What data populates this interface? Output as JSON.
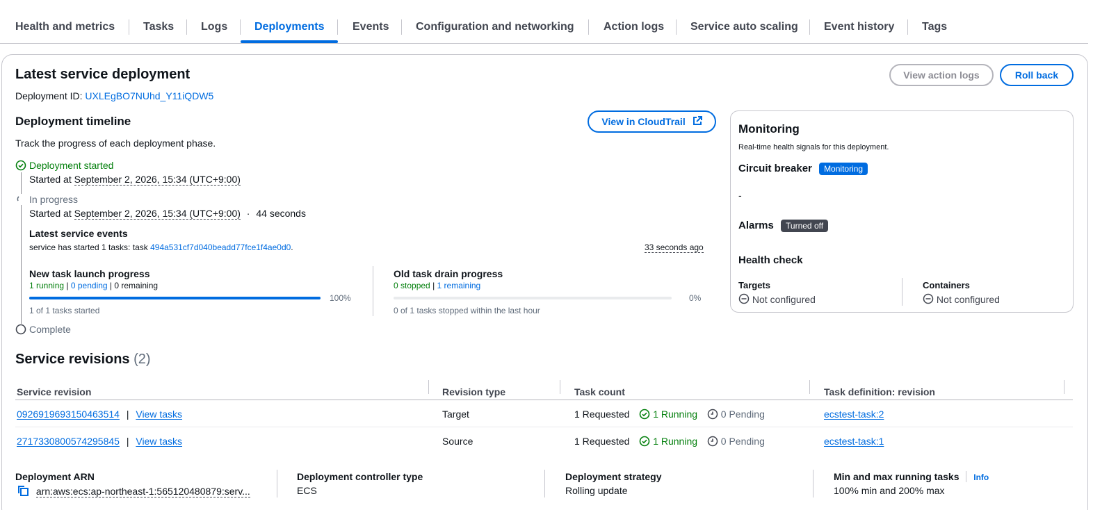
{
  "tabs": [
    {
      "label": "Health and metrics"
    },
    {
      "label": "Tasks"
    },
    {
      "label": "Logs"
    },
    {
      "label": "Deployments"
    },
    {
      "label": "Events"
    },
    {
      "label": "Configuration and networking"
    },
    {
      "label": "Action logs"
    },
    {
      "label": "Service auto scaling"
    },
    {
      "label": "Event history"
    },
    {
      "label": "Tags"
    }
  ],
  "deployment": {
    "title": "Latest service deployment",
    "id_label": "Deployment ID:",
    "id_value": "UXLEgBO7NUhd_Y11iQDW5",
    "view_action_logs": "View action logs",
    "roll_back": "Roll back"
  },
  "timeline": {
    "title": "Deployment timeline",
    "subtitle": "Track the progress of each deployment phase.",
    "cloudtrail_button": "View in CloudTrail",
    "started": {
      "status": "Deployment started",
      "label": "Started at",
      "time": "September 2, 2026, 15:34 (UTC+9:00)"
    },
    "in_progress": {
      "status": "In progress",
      "label": "Started at",
      "time": "September 2, 2026, 15:34 (UTC+9:00)",
      "sep": "·",
      "duration": "44 seconds"
    },
    "events": {
      "title": "Latest service events",
      "text": "service has started 1 tasks: task",
      "task_id": "494a531cf7d040beadd77fce1f4ae0d0",
      "period": ".",
      "ago": "33 seconds ago"
    },
    "new_task": {
      "title": "New task launch progress",
      "running": "1 running",
      "pipe": "|",
      "pending": "0 pending",
      "remaining": "| 0 remaining",
      "percent_label": "100%",
      "progress": 1.0,
      "footer": "1 of 1 tasks started"
    },
    "old_task": {
      "title": "Old task drain progress",
      "stopped": "0 stopped",
      "pipe": "|",
      "remaining": "1 remaining",
      "percent_label": "0%",
      "progress": 0.0,
      "footer": "0 of 1 tasks stopped within the last hour"
    },
    "complete": {
      "status": "Complete"
    }
  },
  "monitoring": {
    "title": "Monitoring",
    "subtitle": "Real-time health signals for this deployment.",
    "circuit_breaker": "Circuit breaker",
    "circuit_badge": "Monitoring",
    "circuit_value": "-",
    "alarms": "Alarms",
    "alarms_badge": "Turned off",
    "health_check": "Health check",
    "targets_label": "Targets",
    "targets_value": "Not configured",
    "containers_label": "Containers",
    "containers_value": "Not configured"
  },
  "revisions": {
    "title": "Service revisions",
    "count": "(2)",
    "columns": [
      "Service revision",
      "Revision type",
      "Task count",
      "Task definition: revision"
    ],
    "rows": [
      {
        "id": "0926919693150463514",
        "sep": "|",
        "view": "View tasks",
        "type": "Target",
        "requested": "1 Requested",
        "running": "1 Running",
        "pending": "0 Pending",
        "taskdef": "ecstest-task:2"
      },
      {
        "id": "2717330800574295845",
        "sep": "|",
        "view": "View tasks",
        "type": "Source",
        "requested": "1 Requested",
        "running": "1 Running",
        "pending": "0 Pending",
        "taskdef": "ecstest-task:1"
      }
    ]
  },
  "details": {
    "arn_label": "Deployment ARN",
    "arn_value": "arn:aws:ecs:ap-northeast-1:565120480879:serv...",
    "controller_label": "Deployment controller type",
    "controller_value": "ECS",
    "strategy_label": "Deployment strategy",
    "strategy_value": "Rolling update",
    "minmax_label": "Min and max running tasks",
    "info": "Info",
    "minmax_value": "100% min and 200% max"
  },
  "colors": {
    "accent": "#006ce0",
    "success": "#037f0c",
    "badge_blue": "#006ce0",
    "badge_dark": "#424650"
  }
}
